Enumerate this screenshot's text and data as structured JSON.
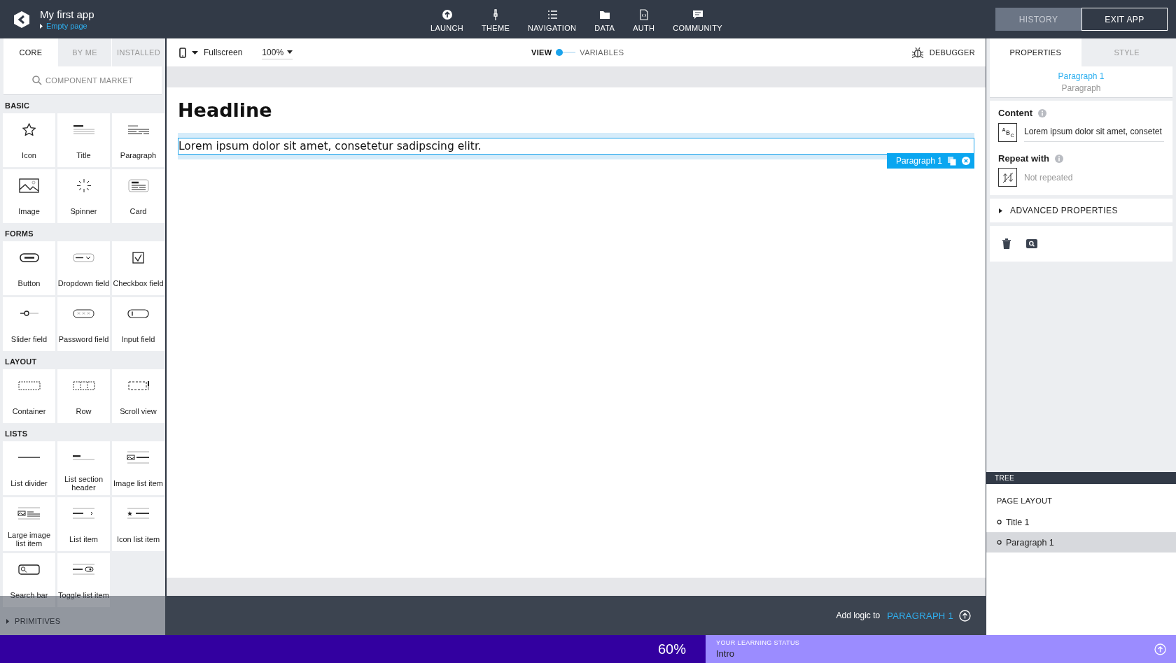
{
  "app": {
    "title": "My first app",
    "page": "Empty page"
  },
  "nav": [
    {
      "label": "LAUNCH",
      "kind": "launch"
    },
    {
      "label": "THEME",
      "kind": "theme"
    },
    {
      "label": "NAVIGATION",
      "kind": "navigation"
    },
    {
      "label": "DATA",
      "kind": "data"
    },
    {
      "label": "AUTH",
      "kind": "auth"
    },
    {
      "label": "COMMUNITY",
      "kind": "community"
    }
  ],
  "header_buttons": [
    {
      "label": "HISTORY",
      "kind": "muted"
    },
    {
      "label": "EXIT APP",
      "kind": "outline"
    }
  ],
  "palette": {
    "tabs": [
      {
        "label": "CORE",
        "selected": true
      },
      {
        "label": "BY ME",
        "selected": false
      },
      {
        "label": "INSTALLED",
        "selected": false
      }
    ],
    "search": {
      "placeholder": "COMPONENT MARKET"
    },
    "sections": [
      {
        "title": "BASIC",
        "items": [
          {
            "label": "Icon",
            "kind": "star"
          },
          {
            "label": "Title",
            "kind": "title"
          },
          {
            "label": "Paragraph",
            "kind": "paragraph"
          },
          {
            "label": "Image",
            "kind": "image"
          },
          {
            "label": "Spinner",
            "kind": "spinner"
          },
          {
            "label": "Card",
            "kind": "card"
          }
        ]
      },
      {
        "title": "FORMS",
        "items": [
          {
            "label": "Button",
            "kind": "button"
          },
          {
            "label": "Dropdown field",
            "kind": "dropdown"
          },
          {
            "label": "Checkbox field",
            "kind": "checkbox"
          },
          {
            "label": "Slider field",
            "kind": "slider"
          },
          {
            "label": "Password field",
            "kind": "password"
          },
          {
            "label": "Input field",
            "kind": "input"
          }
        ]
      },
      {
        "title": "LAYOUT",
        "items": [
          {
            "label": "Container",
            "kind": "container"
          },
          {
            "label": "Row",
            "kind": "row"
          },
          {
            "label": "Scroll view",
            "kind": "scrollview"
          }
        ]
      },
      {
        "title": "LISTS",
        "items": [
          {
            "label": "List divider",
            "kind": "divider"
          },
          {
            "label": "List section header",
            "kind": "sectionheader"
          },
          {
            "label": "Image list item",
            "kind": "imagelist"
          },
          {
            "label": "Large image list item",
            "kind": "largeimagelist"
          },
          {
            "label": "List item",
            "kind": "listitem"
          },
          {
            "label": "Icon list item",
            "kind": "iconlist"
          },
          {
            "label": "Search bar",
            "kind": "searchbar"
          },
          {
            "label": "Toggle list item",
            "kind": "togglelist"
          }
        ]
      }
    ],
    "collapsed_section": "PRIMITIVES"
  },
  "canvas": {
    "device": "Fullscreen",
    "zoom": "100%",
    "toggle": {
      "left": "VIEW",
      "right": "VARIABLES",
      "on": false
    },
    "debugger": "DEBUGGER",
    "headline": "Headline",
    "paragraph": "Lorem ipsum dolor sit amet, consetetur sadipscing elitr.",
    "selection_label": "Paragraph 1"
  },
  "properties": {
    "tabs": [
      {
        "label": "PROPERTIES",
        "selected": true
      },
      {
        "label": "STYLE",
        "selected": false
      }
    ],
    "component": {
      "name": "Paragraph 1",
      "type": "Paragraph"
    },
    "content": {
      "label": "Content",
      "value": "Lorem ipsum dolor sit amet, consetet"
    },
    "repeat": {
      "label": "Repeat with",
      "value": "Not repeated"
    },
    "advanced": {
      "label": "ADVANCED PROPERTIES",
      "expanded": false
    }
  },
  "tree": {
    "title": "TREE",
    "root": "PAGE LAYOUT",
    "items": [
      {
        "label": "Title 1",
        "selected": false
      },
      {
        "label": "Paragraph 1",
        "selected": true
      }
    ]
  },
  "logic_bar": {
    "label": "Add logic to",
    "target": "PARAGRAPH 1"
  },
  "learning": {
    "level": 0.6,
    "percent": "60%",
    "title": "YOUR LEARNING STATUS",
    "stage": "Intro"
  }
}
